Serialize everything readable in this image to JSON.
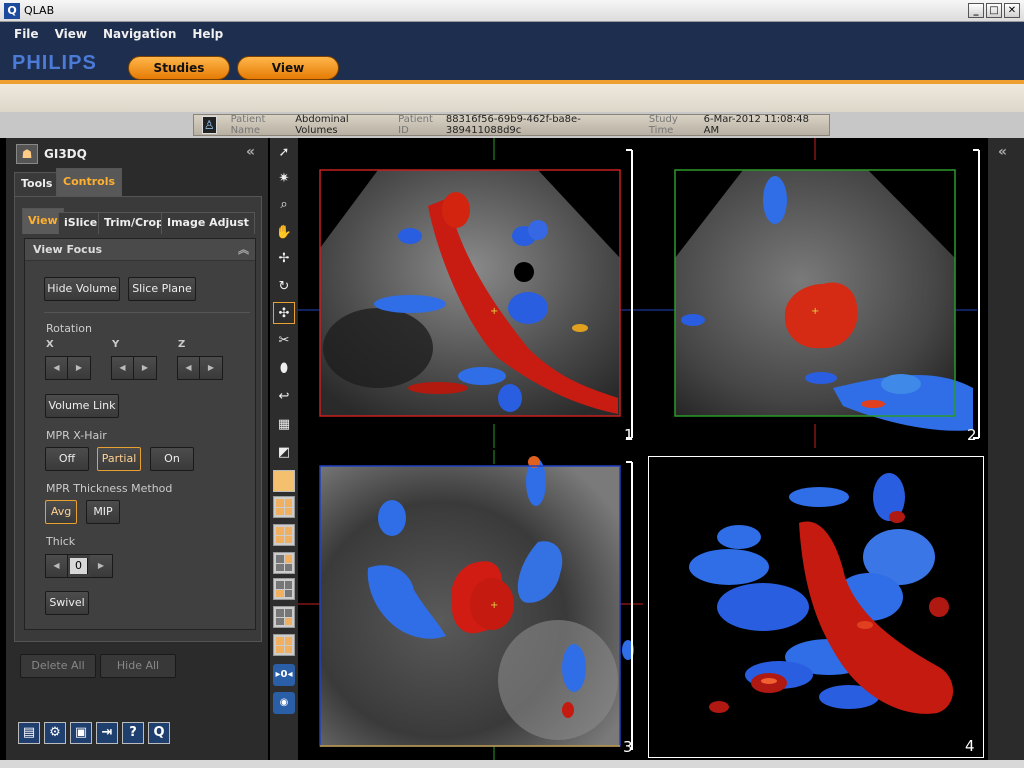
{
  "window": {
    "title": "QLAB",
    "app_icon_letter": "Q"
  },
  "menu": {
    "items": [
      "File",
      "View",
      "Navigation",
      "Help"
    ]
  },
  "brand": {
    "logo": "PHILIPS",
    "tabs": [
      "Studies",
      "View"
    ]
  },
  "patient": {
    "name_label": "Patient Name",
    "name": "Abdominal Volumes",
    "id_label": "Patient ID",
    "id": "88316f56-69b9-462f-ba8e-389411088d9c",
    "time_label": "Study Time",
    "time": "6-Mar-2012 11:08:48 AM"
  },
  "panel": {
    "title": "GI3DQ",
    "tabs": [
      "Tools",
      "Controls"
    ],
    "active_tab": "Controls",
    "subtabs": [
      "View",
      "iSlice",
      "Trim/Crop",
      "Image Adjust"
    ],
    "active_subtab": "View",
    "focus": {
      "title": "View Focus",
      "hide_volume": "Hide Volume",
      "slice_plane": "Slice Plane",
      "rotation_label": "Rotation",
      "axes": [
        "X",
        "Y",
        "Z"
      ],
      "volume_link": "Volume Link",
      "xhair_label": "MPR X-Hair",
      "xhair_options": [
        "Off",
        "Partial",
        "On"
      ],
      "xhair_selected": "Partial",
      "thickness_label": "MPR Thickness Method",
      "thickness_options": [
        "Avg",
        "MIP"
      ],
      "thickness_selected": "Avg",
      "thick_label": "Thick",
      "thick_value": "0",
      "swivel": "Swivel"
    },
    "delete_all": "Delete All",
    "hide_all": "Hide All"
  },
  "viewports": {
    "numbers": [
      "1",
      "2",
      "3",
      "4"
    ],
    "colors": {
      "vp1": "#c62020",
      "vp2": "#2a9a2a",
      "vp3": "#2040c0",
      "vp4": "#ffffff"
    }
  },
  "icons": {
    "toolbar": [
      "arrow-pointer-icon",
      "window-level-icon",
      "zoom-icon",
      "pan-hand-icon",
      "measure-icon",
      "rotate-icon",
      "crosshair-move-icon",
      "scissors-icon",
      "eraser-icon",
      "undo-icon",
      "color-map-icon",
      "invert-icon",
      "layout-1x1-icon",
      "layout-2x2-icon",
      "layout-1x2-icon",
      "layout-quad-a-icon",
      "layout-quad-b-icon",
      "layout-quad-c-icon",
      "layout-quad-d-icon",
      "slice-forward-icon",
      "slice-back-icon"
    ],
    "bottom": [
      "filmstrip-icon",
      "settings-gears-icon",
      "save-icon",
      "export-icon",
      "help-icon",
      "qlab-icon"
    ]
  }
}
